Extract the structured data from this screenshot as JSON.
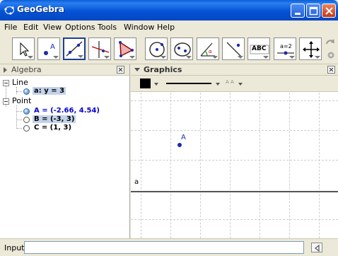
{
  "window": {
    "title": "GeoGebra"
  },
  "menu": [
    "File",
    "Edit",
    "View",
    "Options",
    "Tools",
    "Window",
    "Help"
  ],
  "toolbar": {
    "text_tool_label": "ABC",
    "slider_tool_label": "a=2"
  },
  "algebra": {
    "title": "Algebra",
    "groups": [
      {
        "label": "Line",
        "items": [
          {
            "text": "a: y = 3"
          }
        ]
      },
      {
        "label": "Point",
        "items": [
          {
            "text": "A = (-2.66, 4.54)"
          },
          {
            "text": "B = (-3, 3)"
          },
          {
            "text": "C = (1, 3)"
          }
        ]
      }
    ]
  },
  "graphics": {
    "title": "Graphics",
    "line_label": "a",
    "point_label": "A"
  },
  "input": {
    "label": "Input:",
    "value": ""
  },
  "colors": {
    "titlebar": "#0553d6",
    "point": "#1c2aa8",
    "line": "#555555"
  }
}
